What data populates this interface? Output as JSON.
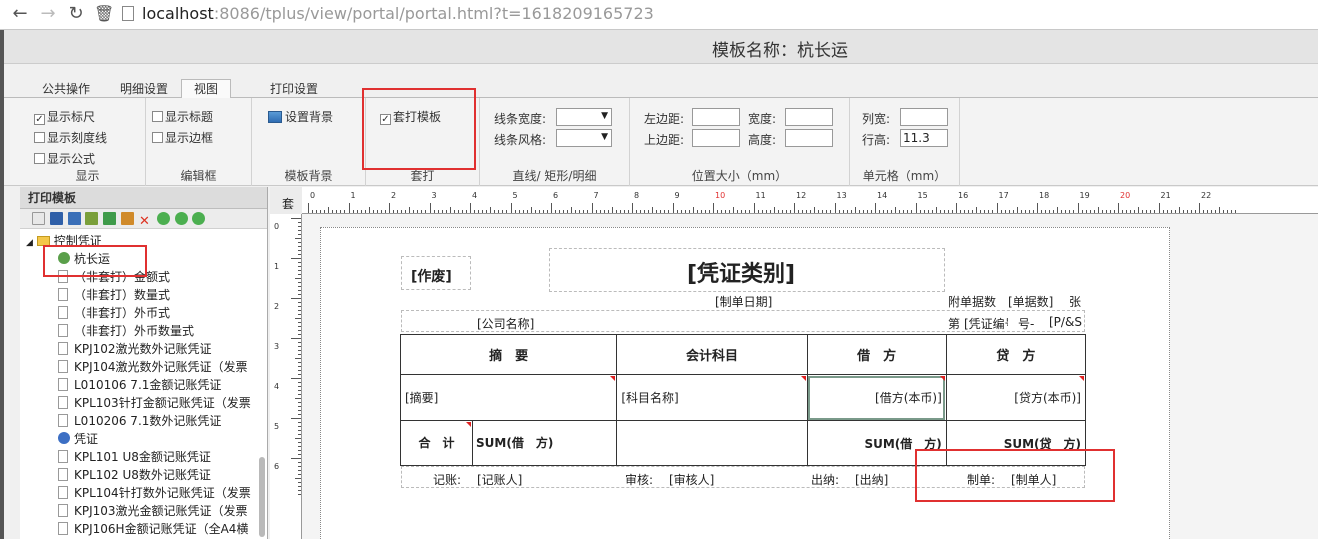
{
  "browser": {
    "url_host": "localhost",
    "url_rest": ":8086/tplus/view/portal/portal.html?t=1618209165723"
  },
  "app": {
    "title": "模板名称：杭长运"
  },
  "tabs": [
    {
      "label": "公共操作"
    },
    {
      "label": "明细设置"
    },
    {
      "label": "视图"
    },
    {
      "label": "打印设置"
    }
  ],
  "ribbon": {
    "display": {
      "label": "显示",
      "show_ruler": "显示标尺",
      "show_scale": "显示刻度线",
      "show_formula": "显示公式"
    },
    "edit_frame": {
      "label": "编辑框",
      "show_title": "显示标题",
      "show_border": "显示边框"
    },
    "template_bg": {
      "label": "模板背景",
      "set_bg": "设置背景"
    },
    "overlay": {
      "label": "套打",
      "overlay_template": "套打模板"
    },
    "lines": {
      "label": "直线/ 矩形/明细",
      "line_width": "线条宽度:",
      "line_style": "线条风格:"
    },
    "position": {
      "label": "位置大小（mm）",
      "left_margin": "左边距:",
      "top_margin": "上边距:",
      "width": "宽度:",
      "height": "高度:"
    },
    "cell": {
      "label": "单元格（mm）",
      "col_width": "列宽:",
      "row_height": "行高:",
      "row_height_value": "11.3"
    }
  },
  "left_panel": {
    "title": "打印模板",
    "root": "控制凭证",
    "items": [
      {
        "label": "杭长运"
      },
      {
        "label": "（非套打）金额式"
      },
      {
        "label": "（非套打）数量式"
      },
      {
        "label": "（非套打）外币式"
      },
      {
        "label": "（非套打）外币数量式"
      },
      {
        "label": "KPJ102激光数外记账凭证"
      },
      {
        "label": "KPJ104激光数外记账凭证（发票"
      },
      {
        "label": "L010106 7.1金额记账凭证"
      },
      {
        "label": "KPL103针打金额记账凭证（发票"
      },
      {
        "label": "L010206 7.1数外记账凭证"
      },
      {
        "label": "凭证"
      },
      {
        "label": "KPL101 U8金额记账凭证"
      },
      {
        "label": "KPL102 U8数外记账凭证"
      },
      {
        "label": "KPL104针打数外记账凭证（发票"
      },
      {
        "label": "KPJ103激光金额记账凭证（发票"
      },
      {
        "label": "KPJ106H金额记账凭证（全A4横"
      }
    ]
  },
  "ruler": {
    "corner": "套",
    "top_numbers": [
      "0",
      "1",
      "2",
      "3",
      "4",
      "5",
      "6",
      "7",
      "8",
      "9",
      "10",
      "11",
      "12",
      "13",
      "14",
      "15",
      "16",
      "17",
      "18",
      "19",
      "20",
      "21",
      "22"
    ],
    "left_numbers": [
      "0",
      "1",
      "2",
      "3",
      "4",
      "5",
      "6"
    ]
  },
  "voucher": {
    "void": "[作废]",
    "type": "[凭证类别]",
    "date": "[制单日期]",
    "attach_label": "附单据数",
    "attach_field": "[单据数]",
    "attach_unit": "张",
    "company": "[公司名称]",
    "no_prefix": "第",
    "voucher_no": "[凭证编号]",
    "no_suffix": "号-",
    "page": "[P/&S]",
    "headers": {
      "summary": "摘　要",
      "account": "会计科目",
      "debit": "借　方",
      "credit": "贷　方"
    },
    "row": {
      "summary": "[摘要]",
      "account": "[科目名称]",
      "debit": "[借方(本币)]",
      "credit": "[贷方(本币)]"
    },
    "total": {
      "label": "合　计",
      "sum_expr": "SUM(借　方)",
      "sum_debit": "SUM(借　方)",
      "sum_credit": "SUM(贷　方)"
    },
    "footer": {
      "bookkeeper_label": "记账:",
      "bookkeeper": "[记账人]",
      "auditor_label": "审核:",
      "auditor": "[审核人]",
      "cashier_label": "出纳:",
      "cashier": "[出纳]",
      "preparer_label": "制单:",
      "preparer": "[制单人]"
    }
  },
  "colors": {
    "highlight": "#e03030",
    "tri_marker": "#e02020"
  }
}
